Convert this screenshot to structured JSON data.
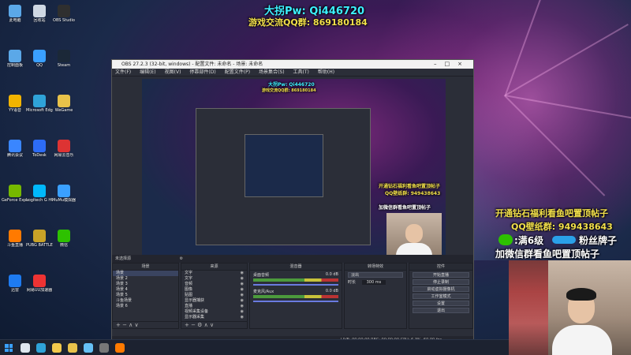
{
  "overlay": {
    "line1": "大拐Pw: Qi446720",
    "line2": "游戏交流QQ群: 869180184",
    "promo1": "开通钻石福利看鱼吧置顶帖子",
    "promo2": "QQ壁纸群: 949438643",
    "promo3": ":满6级",
    "promo4": "粉丝牌子",
    "promo5": "加微信群看鱼吧置顶帖子"
  },
  "desktop_icons": [
    {
      "label": "此电脑",
      "icon": "computer-icon",
      "color": "#5ba8e8"
    },
    {
      "label": "回收站",
      "icon": "recycle-bin-icon",
      "color": "#cfd8e3"
    },
    {
      "label": "OBS Studio",
      "icon": "obs-icon",
      "color": "#2f2f2f"
    },
    {
      "label": "控制面板",
      "icon": "control-panel-icon",
      "color": "#5ba8e8"
    },
    {
      "label": "QQ",
      "icon": "qq-icon",
      "color": "#3aa0ff"
    },
    {
      "label": "Steam",
      "icon": "steam-icon",
      "color": "#1b2838"
    },
    {
      "label": "YY语音",
      "icon": "yy-icon",
      "color": "#f2b400"
    },
    {
      "label": "Microsoft Edge",
      "icon": "edge-icon",
      "color": "#2fa3d8"
    },
    {
      "label": "WeGame",
      "icon": "wegame-icon",
      "color": "#e8c24a"
    },
    {
      "label": "腾讯会议",
      "icon": "meeting-icon",
      "color": "#3a86ff"
    },
    {
      "label": "ToDesk",
      "icon": "todesk-icon",
      "color": "#2d6cf6"
    },
    {
      "label": "网易云音乐",
      "icon": "music-icon",
      "color": "#d33"
    },
    {
      "label": "GeForce Experience",
      "icon": "geforce-icon",
      "color": "#76b900"
    },
    {
      "label": "Logitech G HUB",
      "icon": "ghub-icon",
      "color": "#00b8fc"
    },
    {
      "label": "MuMu模拟器",
      "icon": "mumu-icon",
      "color": "#3aa0ff"
    },
    {
      "label": "斗鱼直播",
      "icon": "douyu-icon",
      "color": "#ff7a00"
    },
    {
      "label": "PUBG BATTLEGROUNDS",
      "icon": "pubg-icon",
      "color": "#c9a227"
    },
    {
      "label": "微信",
      "icon": "wechat-icon",
      "color": "#2dc100"
    },
    {
      "label": "迅雷",
      "icon": "xunlei-icon",
      "color": "#1e7bf0"
    },
    {
      "label": "网易UU加速器",
      "icon": "uu-icon",
      "color": "#e33"
    }
  ],
  "obs": {
    "title": "OBS 27.2.3 (32-bit, windows) - 配置文件: 未命名 - 场景: 未命名",
    "menu": [
      "文件(F)",
      "编辑(E)",
      "视图(V)",
      "停靠部件(D)",
      "配置文件(P)",
      "场景集合(S)",
      "工具(T)",
      "帮助(H)"
    ],
    "scene_bar": "未选择源",
    "dock_titles": [
      "场景",
      "来源",
      "混音器",
      "转场特效",
      "控件"
    ],
    "scenes": [
      "场景",
      "场景 2",
      "场景 3",
      "场景 4",
      "场景 5",
      "斗鱼场景",
      "场景 6"
    ],
    "sources": [
      "文字",
      "文字",
      "音频",
      "图像",
      "贴图",
      "显示器捕获",
      "直播",
      "视频采集设备",
      "显示器采集"
    ],
    "mixer": [
      {
        "name": "桌面音频",
        "db": "0.0 dB"
      },
      {
        "name": "麦克风/Aux",
        "db": "0.0 dB"
      }
    ],
    "transition": {
      "type": "淡出",
      "duration_label": "时长",
      "duration": "300 ms"
    },
    "controls": [
      "开始直播",
      "停止录制",
      "启动虚拟摄像机",
      "工作室模式",
      "设置",
      "退出"
    ],
    "status": "LIVE: 00:00:00   REC: 00:00:00   CPU: 6.3%, 60.00 fps"
  },
  "taskbar": [
    {
      "icon": "search-icon",
      "color": "#dfe6ee"
    },
    {
      "icon": "edge-icon",
      "color": "#2fa3d8"
    },
    {
      "icon": "folder-icon",
      "color": "#f2c94c"
    },
    {
      "icon": "wegame-icon",
      "color": "#e8c24a"
    },
    {
      "icon": "steam-icon",
      "color": "#66c0f4"
    },
    {
      "icon": "obs-icon",
      "color": "#777"
    },
    {
      "icon": "douyu-icon",
      "color": "#ff7a00"
    }
  ]
}
